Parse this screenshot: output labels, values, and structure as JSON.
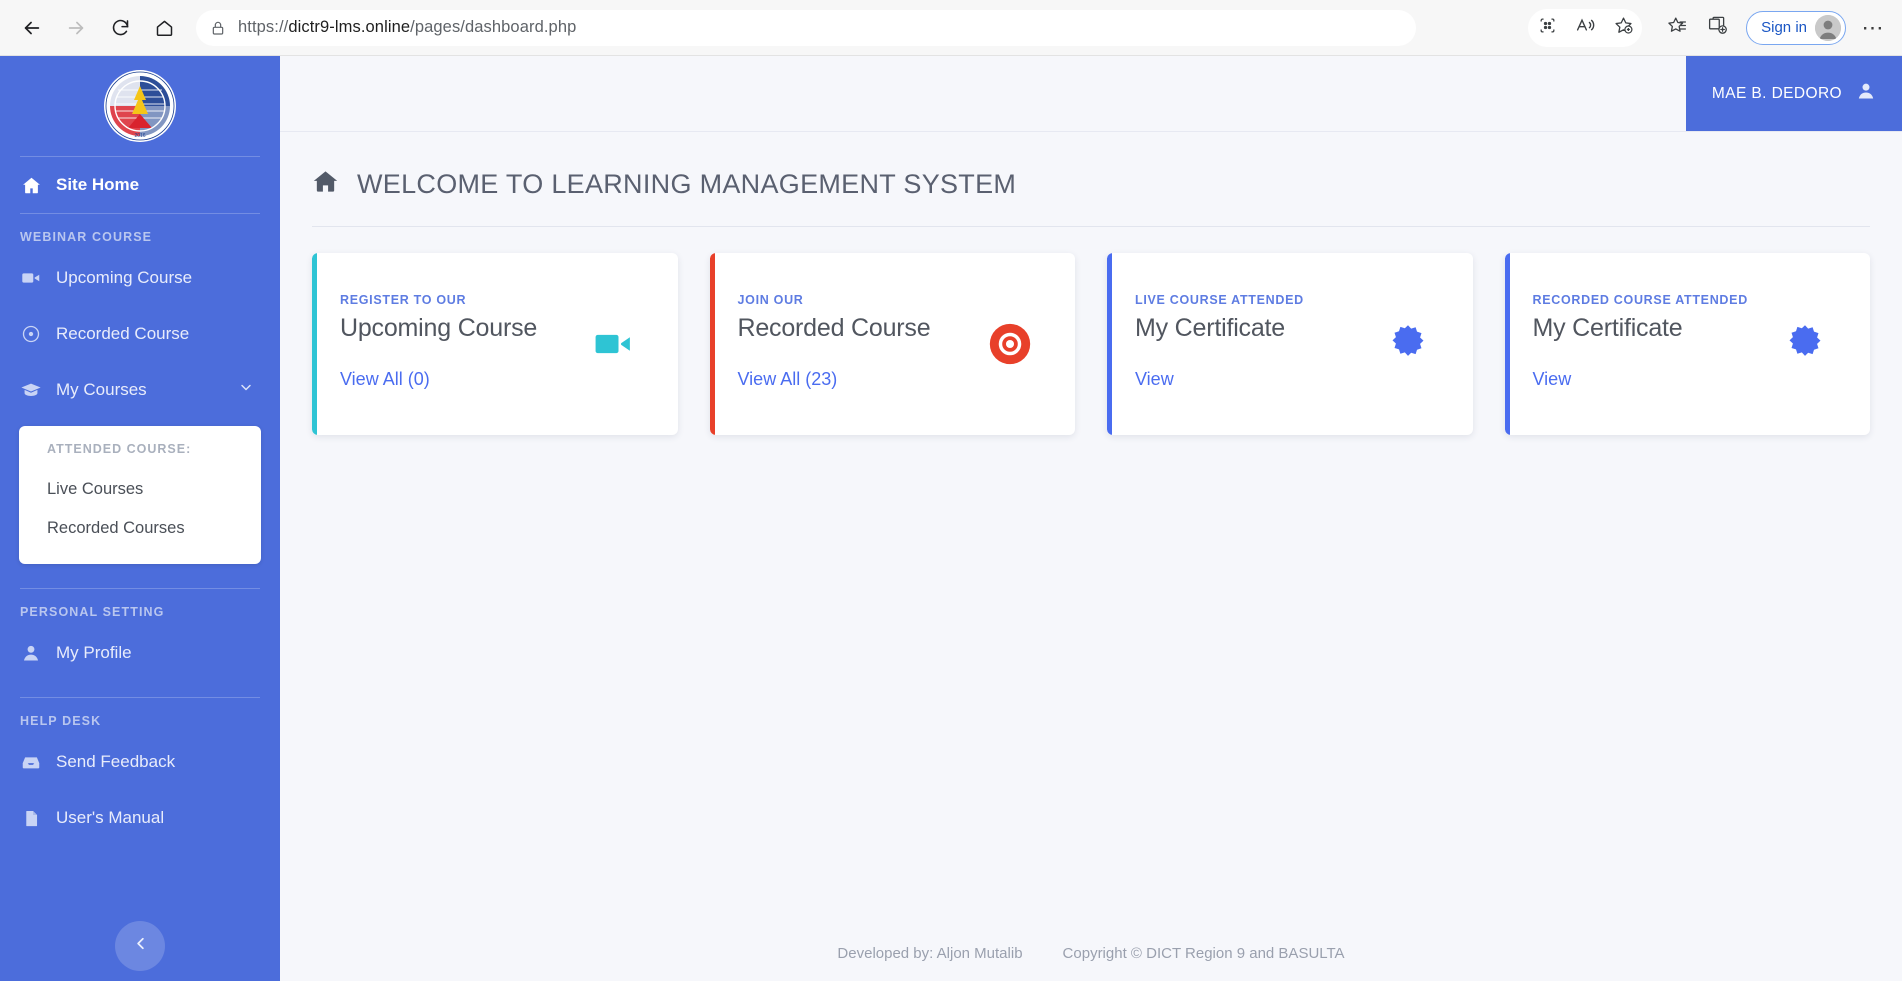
{
  "browser": {
    "url_prefix": "https://",
    "url_bold": "dictr9-lms.online",
    "url_suffix": "/pages/dashboard.php",
    "url_full": "https://dictr9-lms.online/pages/dashboard.php",
    "back_icon": "back-arrow-icon",
    "forward_icon": "forward-arrow-icon",
    "refresh_icon": "refresh-icon",
    "home_icon": "home-icon",
    "lock_icon": "lock-icon",
    "apps_icon": "app-grid-icon",
    "read_aloud_icon": "read-aloud-icon",
    "favorite_icon": "add-favorite-icon",
    "collections_icon": "collections-icon",
    "split_screen_icon": "split-screen-icon",
    "signin_label": "Sign in",
    "settings_icon": "more-options-icon"
  },
  "sidebar": {
    "logo_alt": "dict-seal-logo",
    "logo_year": "2016",
    "home": {
      "label": "Site Home",
      "icon": "home-icon"
    },
    "sections": [
      {
        "title": "WEBINAR COURSE",
        "items": [
          {
            "label": "Upcoming Course",
            "icon": "video-camera-icon",
            "has_chevron": false
          },
          {
            "label": "Recorded Course",
            "icon": "record-disc-icon",
            "has_chevron": false
          },
          {
            "label": "My Courses",
            "icon": "graduation-cap-icon",
            "has_chevron": true
          }
        ]
      },
      {
        "title": "PERSONAL SETTING",
        "items": [
          {
            "label": "My Profile",
            "icon": "user-icon",
            "has_chevron": false
          }
        ]
      },
      {
        "title": "HELP DESK",
        "items": [
          {
            "label": "Send Feedback",
            "icon": "inbox-icon",
            "has_chevron": false
          },
          {
            "label": "User's Manual",
            "icon": "document-icon",
            "has_chevron": false
          }
        ]
      }
    ],
    "submenu": {
      "title": "ATTENDED COURSE:",
      "items": [
        {
          "label": "Live Courses"
        },
        {
          "label": "Recorded Courses"
        }
      ]
    },
    "collapse_icon": "chevron-left-icon",
    "background_color": "#4c6ddb"
  },
  "header": {
    "user_name": "MAE B. DEDORO",
    "user_icon": "user-avatar-icon",
    "badge_color": "#4c6ddb"
  },
  "page": {
    "title": "WELCOME TO LEARNING MANAGEMENT SYSTEM",
    "title_icon": "home-icon"
  },
  "cards": [
    {
      "eyebrow": "REGISTER TO OUR",
      "title": "Upcoming Course",
      "link": "View All (0)",
      "icon": "video-camera-icon",
      "accent": "#2ec4d4",
      "icon_color": "#2ec4d4"
    },
    {
      "eyebrow": "JOIN OUR",
      "title": "Recorded Course",
      "link": "View All (23)",
      "icon": "record-disc-icon",
      "accent": "#e8402a",
      "icon_color": "#e8402a"
    },
    {
      "eyebrow": "LIVE COURSE ATTENDED",
      "title": "My Certificate",
      "link": "View",
      "icon": "certificate-badge-icon",
      "accent": "#4a6cf0",
      "icon_color": "#4a6cf0"
    },
    {
      "eyebrow": "RECORDED COURSE ATTENDED",
      "title": "My Certificate",
      "link": "View",
      "icon": "certificate-badge-icon",
      "accent": "#4a6cf0",
      "icon_color": "#4a6cf0"
    }
  ],
  "footer": {
    "developed_by": "Developed by: Aljon Mutalib",
    "copyright": "Copyright © DICT Region 9 and BASULTA"
  }
}
